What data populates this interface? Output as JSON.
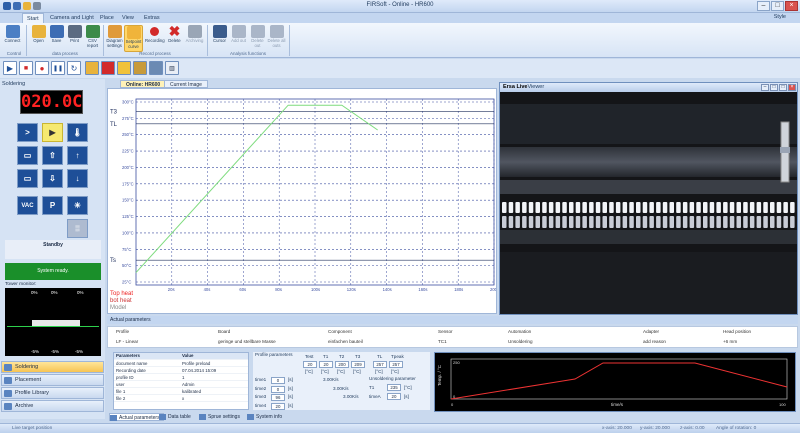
{
  "window": {
    "title": "FIRSoft - Online - HR600"
  },
  "ribbon_tabs": [
    "Start",
    "Camera and Light",
    "Place",
    "View",
    "Extras"
  ],
  "style_label": "Style",
  "ribbon": {
    "buttons": [
      {
        "label": "Connect",
        "color": "#4b7fc4"
      },
      {
        "label": "Open",
        "color": "#e8b33c"
      },
      {
        "label": "Save",
        "color": "#3d6db4"
      },
      {
        "label": "Print",
        "color": "#5b6b82"
      },
      {
        "label": "CSV report",
        "color": "#3c8b4a"
      },
      {
        "label": "Diagram settings",
        "color": "#e09a3a"
      },
      {
        "label": "Setpoint curve",
        "color": "#f0b43a"
      },
      {
        "label": "Recording",
        "color": "#d22a2a"
      },
      {
        "label": "Delete",
        "color": "#d22a2a"
      },
      {
        "label": "Archiving",
        "color": "#9aa6b6"
      },
      {
        "label": "Cursor",
        "color": "#3b5c8c"
      },
      {
        "label": "Add out",
        "color": "#aab6c8"
      },
      {
        "label": "Delete out",
        "color": "#aab6c8"
      },
      {
        "label": "Delete all outs",
        "color": "#aab6c8"
      }
    ],
    "groups": [
      "Control",
      "data process",
      "Record process",
      "Analysis functions"
    ]
  },
  "toolbar_icons": [
    "play-icon",
    "stop-icon",
    "record-icon",
    "pause-icon",
    "refresh-icon",
    "camera-icon",
    "chart-icon",
    "heat-icon",
    "nozzle-icon",
    "vision-icon",
    "placement-icon"
  ],
  "left": {
    "title": "Soldering",
    "temperature_display": "020.0C",
    "controls": [
      ">",
      "▶",
      "🌡",
      "▭",
      "⇧",
      "↑",
      "▭",
      "⇩",
      "↓",
      "VAC",
      "P",
      "✳",
      "▒"
    ],
    "standby": "Standby",
    "system_status": "System ready.",
    "tower_monitor_label": "Tower monitor:",
    "tower_top": [
      "0%",
      "0%",
      "0%"
    ],
    "tower_bottom": [
      "-5%",
      "-5%",
      "-5%"
    ],
    "nav": [
      {
        "label": "Soldering",
        "active": true
      },
      {
        "label": "Placement",
        "active": false
      },
      {
        "label": "Profile Library",
        "active": false
      },
      {
        "label": "Archive",
        "active": false
      }
    ]
  },
  "doc_tabs": [
    "Online: HR600",
    "Current Image"
  ],
  "chart_data": {
    "type": "line",
    "y_ticks": [
      "300°C",
      "275°C",
      "250°C",
      "225°C",
      "200°C",
      "175°C",
      "150°C",
      "125°C",
      "100°C",
      "75°C",
      "50°C",
      "25°C"
    ],
    "x_ticks": [
      "20s",
      "40s",
      "60s",
      "80s",
      "100s",
      "120s",
      "140s",
      "160s",
      "180s",
      "200s"
    ],
    "ylim": [
      0,
      300
    ],
    "xlim": [
      0,
      200
    ],
    "marker_labels": [
      {
        "label": "T3",
        "y": 280
      },
      {
        "label": "TL",
        "y": 260
      },
      {
        "label": "Ts",
        "y": 40
      }
    ],
    "series": [
      {
        "color": "#7fdc7f",
        "x": [
          0,
          85,
          115,
          135
        ],
        "y": [
          20,
          290,
          290,
          250
        ]
      }
    ],
    "heat_labels": [
      "Top heat",
      "bot heat",
      "Model"
    ],
    "grid": true
  },
  "camera": {
    "title_bold": "Ersa Live",
    "title_rest": "Viewer"
  },
  "actual_parameters": {
    "header": "Actual parameters",
    "columns": [
      "Profile",
      "Board",
      "Component",
      "Sensor",
      "Automation",
      "Adapter",
      "Head position"
    ],
    "values": [
      "LF - Linear",
      "geringe und stellbare Masse",
      "einfachen bauteil",
      "TC1",
      "Unsoldering",
      "add reason",
      "+6 mm"
    ]
  },
  "params_table": {
    "headers": [
      "Parameters",
      "Value"
    ],
    "rows": [
      [
        "document name",
        "Profile preload"
      ],
      [
        "Recording date",
        "07.04.2014 15:09"
      ],
      [
        "profile ID",
        "1"
      ],
      [
        "user",
        "Admin"
      ],
      [
        "file 1",
        "kalibrated"
      ],
      [
        "file 2",
        "x"
      ]
    ]
  },
  "profile_params": {
    "title": "Profile parameters",
    "col_headers": [
      "Test",
      "T1",
      "T2",
      "T3"
    ],
    "tl_label": "TL",
    "tpeak_label": "Tpeak",
    "row1": [
      "20",
      "20",
      "200",
      "209"
    ],
    "tl_value": "257",
    "tpeak_value": "257",
    "units_row": [
      "[°C]",
      "[°C]",
      "[°C]",
      "[°C]"
    ],
    "units_tl": "[°C]",
    "units_tpeak": "[°C]",
    "times": [
      {
        "label": "time1",
        "value": "0",
        "unit": "[s]",
        "rate": "3.00K/s"
      },
      {
        "label": "time2",
        "value": "0",
        "unit": "[s]",
        "rate": "3.00K/s"
      },
      {
        "label": "time3",
        "value": "96",
        "unit": "[s]",
        "rate": "3.00K/s"
      },
      {
        "label": "time4",
        "value": "20",
        "unit": "[s]",
        "rate": ""
      }
    ],
    "unsoldering_title": "Unsoldering parameter",
    "unsoldering": [
      {
        "label": "T1",
        "value": "235",
        "unit": "[°C]"
      },
      {
        "label": "timeA",
        "value": "20",
        "unit": "[s]"
      }
    ]
  },
  "mini_chart": {
    "ylabel": "Temp. / °C",
    "xlabel": "time/s",
    "y_ticks": [
      "250",
      "0"
    ],
    "x_ticks": [
      "0",
      "100"
    ]
  },
  "bottom_tabs": [
    "Actual parameters",
    "Data table",
    "Sprue settings",
    "System info"
  ],
  "status": {
    "left": "Live target position",
    "items": [
      "x-axis: 20.000",
      "y-axis: 20.000",
      "z-axis: 0.00",
      "Angle of rotation: 0"
    ]
  }
}
